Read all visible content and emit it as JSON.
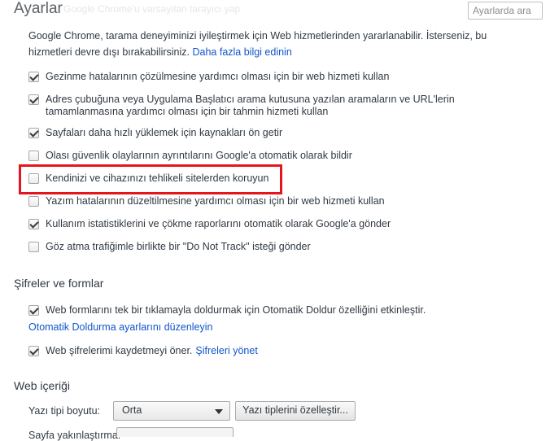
{
  "header": {
    "title": "Ayarlar",
    "ghost_text": "Google Chrome'u varsayılan tarayıcı yap",
    "search_placeholder": "Ayarlarda ara"
  },
  "privacy": {
    "intro": "Google Chrome, tarama deneyiminizi iyileştirmek için Web hizmetlerinden yararlanabilir. İsterseniz, bu hizmetleri devre dışı bırakabilirsiniz.",
    "intro_link": "Daha fazla bilgi edinin",
    "options": [
      {
        "label": "Gezinme hatalarının çözülmesine yardımcı olması için bir web hizmeti kullan",
        "checked": true
      },
      {
        "label": "Adres çubuğuna veya Uygulama Başlatıcı arama kutusuna yazılan aramaların ve URL'lerin tamamlanmasına yardımcı olması için bir tahmin hizmeti kullan",
        "checked": true
      },
      {
        "label": "Sayfaları daha hızlı yüklemek için kaynakları ön getir",
        "checked": true
      },
      {
        "label": "Olası güvenlik olaylarının ayrıntılarını Google'a otomatik olarak bildir",
        "checked": false
      },
      {
        "label": "Kendinizi ve cihazınızı tehlikeli sitelerden koruyun",
        "checked": false
      },
      {
        "label": "Yazım hatalarının düzeltilmesine yardımcı olması için bir web hizmeti kullan",
        "checked": false
      },
      {
        "label": "Kullanım istatistiklerini ve çökme raporlarını otomatik olarak Google'a gönder",
        "checked": true
      },
      {
        "label": "Göz atma trafiğimle birlikte bir \"Do Not Track\" isteği gönder",
        "checked": false
      }
    ]
  },
  "passwords": {
    "heading": "Şifreler ve formlar",
    "autofill_label": "Web formlarını tek bir tıklamayla doldurmak için Otomatik Doldur özelliğini etkinleştir.",
    "autofill_checked": true,
    "autofill_link": "Otomatik Doldurma ayarlarını düzenleyin",
    "save_passwords_label": "Web şifrelerimi kaydetmeyi öner.",
    "save_passwords_checked": true,
    "manage_passwords_link": "Şifreleri yönet"
  },
  "web_content": {
    "heading": "Web içeriği",
    "font_size_label": "Yazı tipi boyutu:",
    "font_size_value": "Orta",
    "customize_fonts_button": "Yazı tiplerini özelleştir...",
    "page_zoom_label": "Sayfa yakınlaştırma:"
  },
  "colors": {
    "highlight": "#e5151d",
    "link": "#1155cc"
  }
}
